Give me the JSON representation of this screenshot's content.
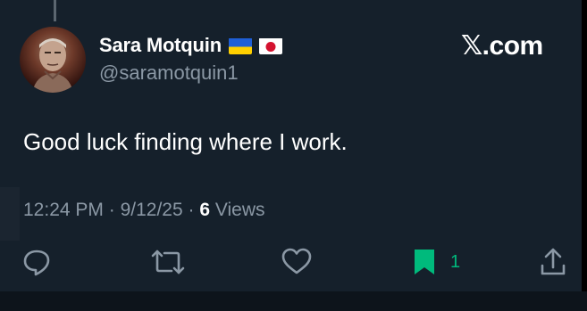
{
  "post": {
    "display_name": "Sara Motquin",
    "flags": [
      "ukraine-flag",
      "japan-flag"
    ],
    "handle": "@saramotquin1",
    "text": "Good luck finding where I work.",
    "time": "12:24 PM",
    "date": "9/12/25",
    "separator": "·",
    "views_count": "6",
    "views_label": "Views"
  },
  "brand": {
    "label": "𝕏.com"
  },
  "actions": {
    "reply_icon": "reply-icon",
    "repost_icon": "repost-icon",
    "like_icon": "like-icon",
    "bookmark_icon": "bookmark-icon",
    "bookmark_count": "1",
    "share_icon": "share-icon"
  },
  "colors": {
    "background": "#15202b",
    "muted_text": "#8b98a5",
    "bookmark_active": "#00ba7c",
    "icon": "#8b98a5"
  }
}
